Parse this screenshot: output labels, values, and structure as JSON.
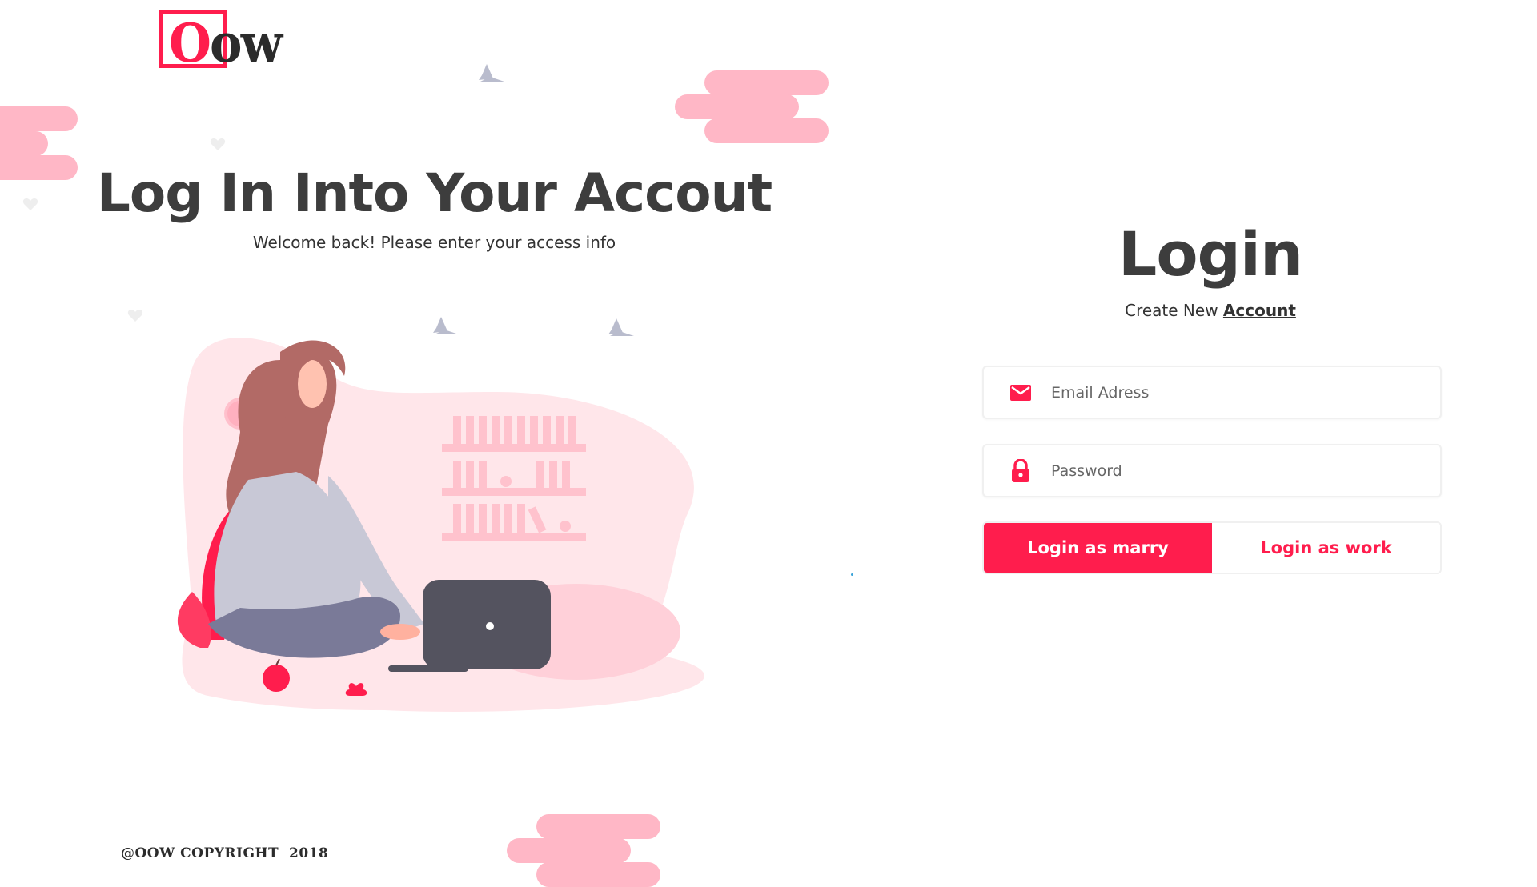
{
  "brand": {
    "logo_first": "O",
    "logo_rest": "ow",
    "accent": "#ff1d4d",
    "pill_color": "#ffb7c6"
  },
  "hero": {
    "title": "Log In Into Your Accout",
    "subtitle": "Welcome back! Please enter your access info"
  },
  "login": {
    "title": "Login",
    "create_prefix": "Create New",
    "create_link": "Account",
    "email_placeholder": "Email Adress",
    "password_placeholder": "Password",
    "primary_button": "Login as marry",
    "secondary_button": "Login as work"
  },
  "icons": {
    "email": "envelope-icon",
    "password": "lock-icon"
  },
  "footer": {
    "copyright": "@OOW COPYRIGHT  2018"
  }
}
